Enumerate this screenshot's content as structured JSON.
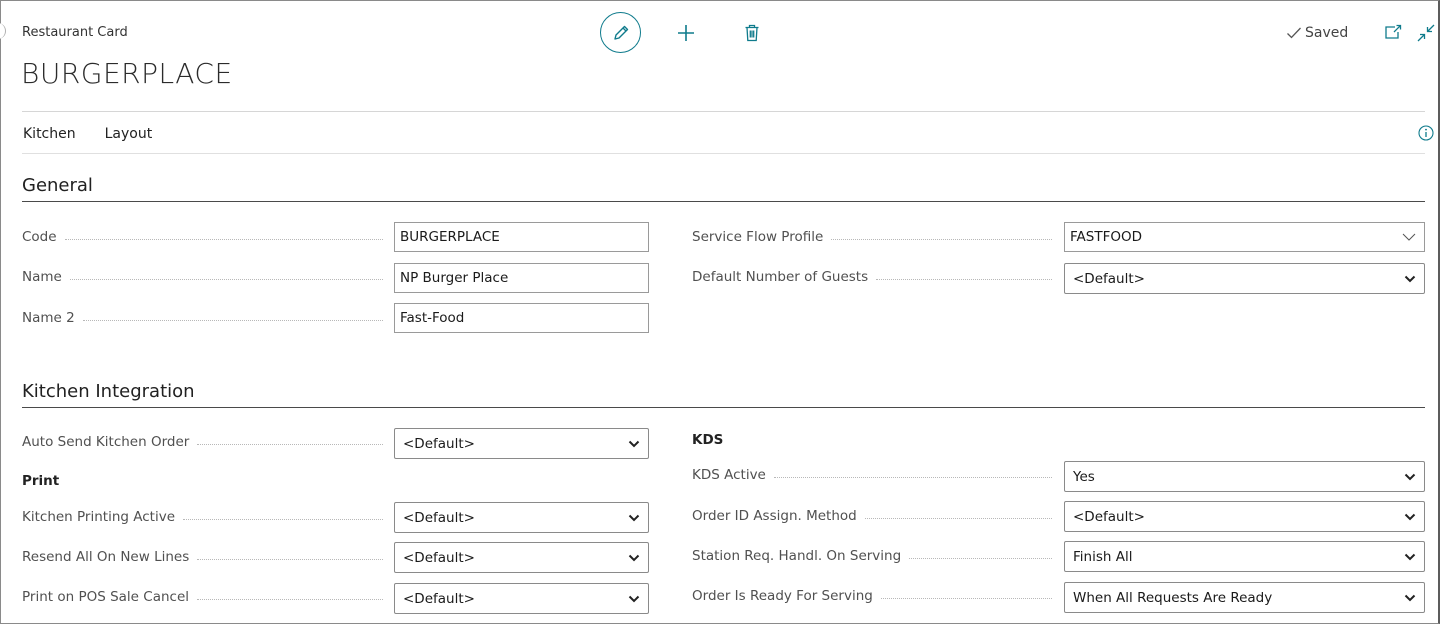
{
  "header": {
    "page_type": "Restaurant Card",
    "title": "BURGERPLACE",
    "status": "Saved"
  },
  "toolbar": {
    "edit_icon": "pencil-icon",
    "new_icon": "plus-icon",
    "delete_icon": "trash-icon",
    "popout_icon": "open-in-new-window-icon",
    "collapse_icon": "collapse-icon",
    "info_icon": "info-icon"
  },
  "actions": [
    "Kitchen",
    "Layout"
  ],
  "general": {
    "title": "General",
    "code": {
      "label": "Code",
      "value": "BURGERPLACE"
    },
    "name": {
      "label": "Name",
      "value": "NP Burger Place"
    },
    "name2": {
      "label": "Name 2",
      "value": "Fast-Food"
    },
    "service_flow_profile": {
      "label": "Service Flow Profile",
      "value": "FASTFOOD"
    },
    "default_number_of_guests": {
      "label": "Default Number of Guests",
      "value": "<Default>"
    }
  },
  "kitchen_integration": {
    "title": "Kitchen Integration",
    "auto_send_kitchen_order": {
      "label": "Auto Send Kitchen Order",
      "value": "<Default>"
    },
    "print_group": "Print",
    "kitchen_printing_active": {
      "label": "Kitchen Printing Active",
      "value": "<Default>"
    },
    "resend_all_on_new_lines": {
      "label": "Resend All On New Lines",
      "value": "<Default>"
    },
    "print_on_pos_sale_cancel": {
      "label": "Print on POS Sale Cancel",
      "value": "<Default>"
    },
    "kds_group": "KDS",
    "kds_active": {
      "label": "KDS Active",
      "value": "Yes"
    },
    "order_id_assign_method": {
      "label": "Order ID Assign. Method",
      "value": "<Default>"
    },
    "station_req_handl_on_serving": {
      "label": "Station Req. Handl. On Serving",
      "value": "Finish All"
    },
    "order_is_ready_for_serving": {
      "label": "Order Is Ready For Serving",
      "value": "When All Requests Are Ready"
    }
  },
  "colors": {
    "accent": "#0f7b8c",
    "section_rule": "#4a4a4a"
  }
}
